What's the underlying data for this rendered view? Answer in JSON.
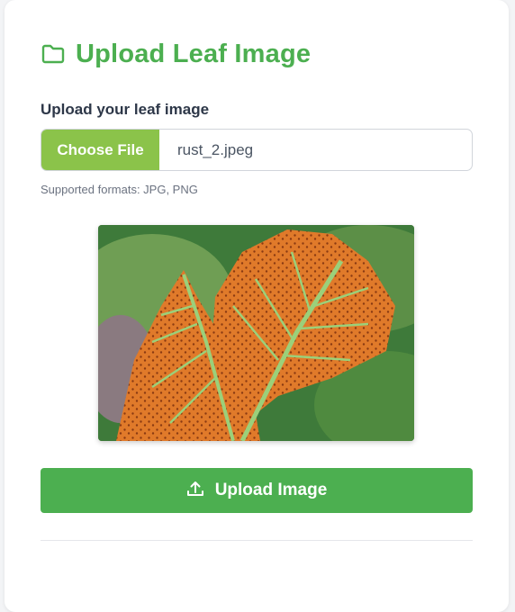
{
  "header": {
    "icon": "folder-icon",
    "title": "Upload Leaf Image"
  },
  "form": {
    "label": "Upload your leaf image",
    "choose_label": "Choose File",
    "file_name": "rust_2.jpeg",
    "hint": "Supported formats: JPG, PNG"
  },
  "preview": {
    "subject": "rust-infected leaf photo"
  },
  "upload_button": {
    "icon": "upload-icon",
    "label": "Upload Image"
  },
  "colors": {
    "accent": "#4caf50",
    "choose_button": "#8bc34a"
  }
}
